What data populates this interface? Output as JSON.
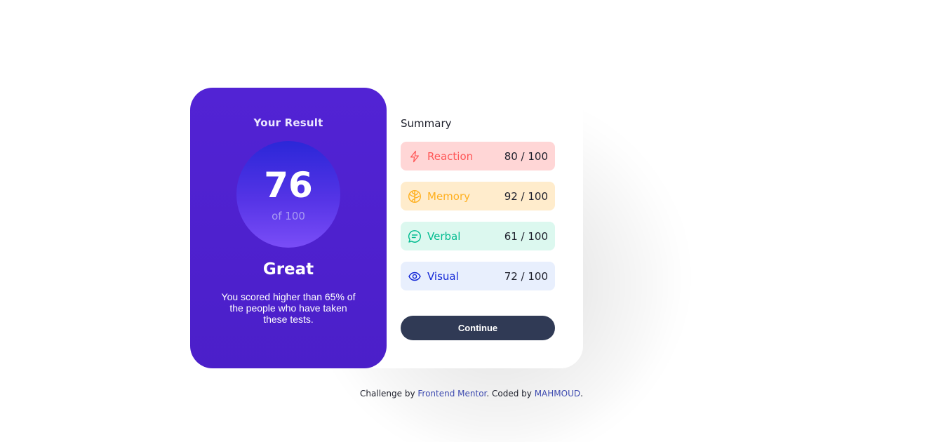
{
  "result": {
    "title": "Your Result",
    "score": "76",
    "score_total": "of 100",
    "verdict": "Great",
    "description": "You scored higher than 65% of the people who have taken these tests."
  },
  "summary": {
    "title": "Summary",
    "items": [
      {
        "label": "Reaction",
        "value": "80 / 100",
        "icon": "lightning-icon",
        "color": "#ff5757",
        "bg": "#ffd6d6"
      },
      {
        "label": "Memory",
        "value": "92 / 100",
        "icon": "brain-icon",
        "color": "#ffb01f",
        "bg": "#ffeccc"
      },
      {
        "label": "Verbal",
        "value": "61 / 100",
        "icon": "chat-bubble-icon",
        "color": "#00bb8f",
        "bg": "#dcf8ef"
      },
      {
        "label": "Visual",
        "value": "72 / 100",
        "icon": "eye-icon",
        "color": "#1125d6",
        "bg": "#e8effd"
      }
    ],
    "continue_label": "Continue"
  },
  "footer": {
    "prefix": "Challenge by ",
    "link1": "Frontend Mentor",
    "middle": ". Coded by ",
    "link2": "MAHMOUD",
    "suffix": "."
  },
  "colors": {
    "result_bg": "#5223d4",
    "button_bg": "#303a55",
    "link": "#3e4bb0"
  }
}
